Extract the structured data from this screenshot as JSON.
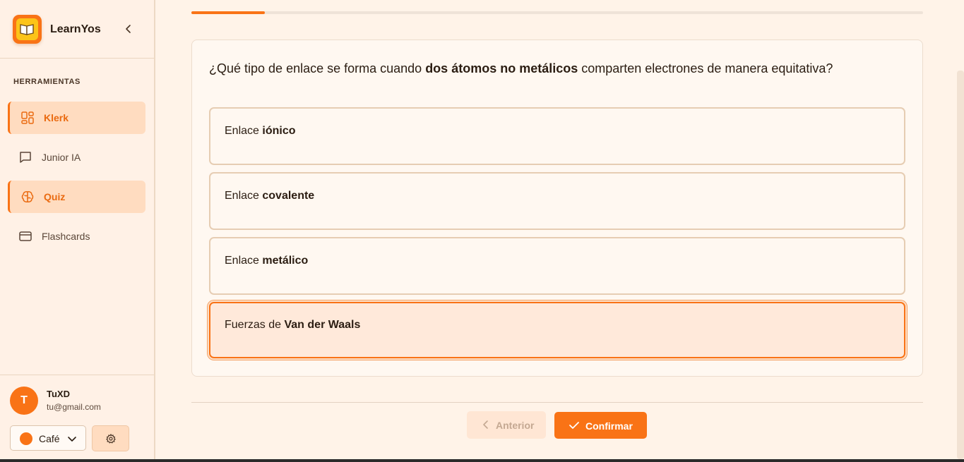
{
  "brand": {
    "name": "LearnYos"
  },
  "sidebar": {
    "section_label": "HERRAMIENTAS",
    "items": [
      {
        "label": "Klerk",
        "icon": "grid-icon",
        "active": true
      },
      {
        "label": "Junior IA",
        "icon": "chat-icon",
        "active": false
      },
      {
        "label": "Quiz",
        "icon": "brain-icon",
        "active": true
      },
      {
        "label": "Flashcards",
        "icon": "card-icon",
        "active": false
      }
    ]
  },
  "user": {
    "initial": "T",
    "name": "TuXD",
    "email": "tu@gmail.com",
    "theme": "Café"
  },
  "quiz": {
    "progress_percent": 10,
    "question": {
      "before": "¿Qué tipo de enlace se forma cuando ",
      "bold": "dos átomos no metálicos",
      "after": " comparten electrones de manera equitativa?"
    },
    "options": [
      {
        "prefix": "Enlace ",
        "bold": "iónico"
      },
      {
        "prefix": "Enlace ",
        "bold": "covalente"
      },
      {
        "prefix": "Enlace ",
        "bold": "metálico"
      },
      {
        "prefix": "Fuerzas de ",
        "bold": "Van der Waals"
      }
    ],
    "selected_index": 3,
    "prev_label": "Anterior",
    "confirm_label": "Confirmar"
  },
  "colors": {
    "accent": "#f97316",
    "background": "#fff3e8",
    "active_nav": "#ffdcc0"
  }
}
